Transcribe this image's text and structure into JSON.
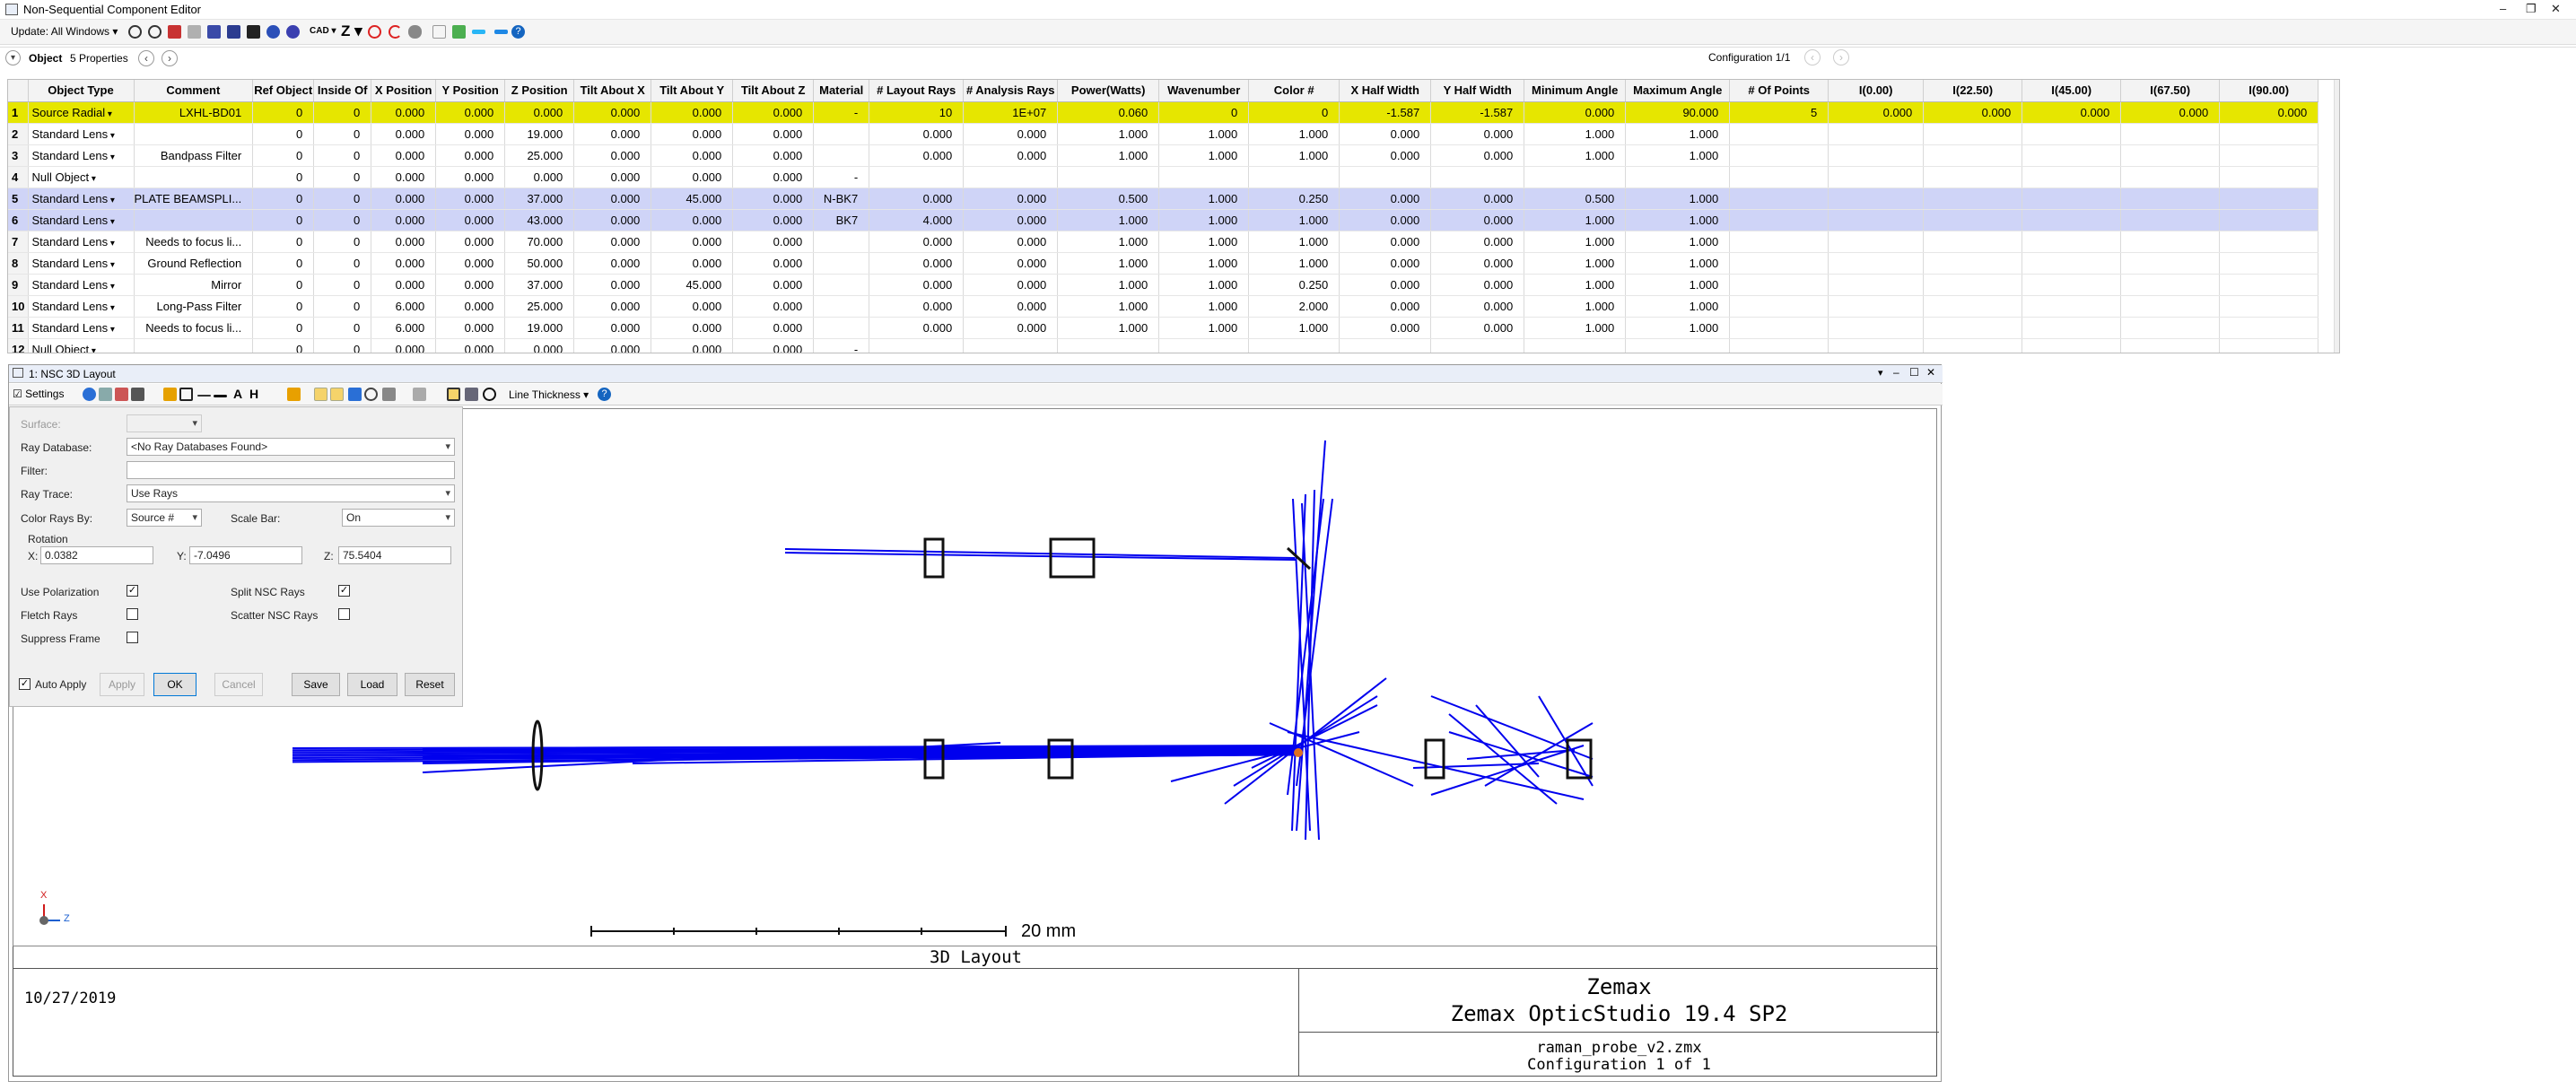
{
  "window": {
    "title": "Non-Sequential Component Editor"
  },
  "toolbar": {
    "update_label": "Update: All Windows",
    "cad_label": "CAD",
    "z_label": "Z"
  },
  "config": {
    "label": "Configuration 1/1"
  },
  "objectbar": {
    "title": "Object",
    "properties": "5 Properties"
  },
  "table": {
    "headers": [
      "Object Type",
      "Comment",
      "Ref Object",
      "Inside Of",
      "X Position",
      "Y Position",
      "Z Position",
      "Tilt About X",
      "Tilt About Y",
      "Tilt About Z",
      "Material",
      "# Layout Rays",
      "# Analysis Rays",
      "Power(Watts)",
      "Wavenumber",
      "Color #",
      "X Half Width",
      "Y Half Width",
      "Minimum Angle",
      "Maximum Angle",
      "# Of Points",
      "I(0.00)",
      "I(22.50)",
      "I(45.00)",
      "I(67.50)",
      "I(90.00)"
    ],
    "rows": [
      [
        "1",
        "Source Radial",
        "LXHL-BD01",
        "0",
        "0",
        "0.000",
        "0.000",
        "0.000",
        "0.000",
        "0.000",
        "0.000",
        "-",
        "10",
        "1E+07",
        "0.060",
        "0",
        "0",
        "-1.587",
        "-1.587",
        "0.000",
        "90.000",
        "5",
        "0.000",
        "0.000",
        "0.000",
        "0.000",
        "0.000"
      ],
      [
        "2",
        "Standard Lens",
        "",
        "0",
        "0",
        "0.000",
        "0.000",
        "19.000",
        "0.000",
        "0.000",
        "0.000",
        "",
        "0.000",
        "0.000",
        "1.000",
        "1.000",
        "1.000",
        "0.000",
        "0.000",
        "1.000",
        "1.000",
        "",
        "",
        "",
        "",
        "",
        ""
      ],
      [
        "3",
        "Standard Lens",
        "Bandpass Filter",
        "0",
        "0",
        "0.000",
        "0.000",
        "25.000",
        "0.000",
        "0.000",
        "0.000",
        "",
        "0.000",
        "0.000",
        "1.000",
        "1.000",
        "1.000",
        "0.000",
        "0.000",
        "1.000",
        "1.000",
        "",
        "",
        "",
        "",
        "",
        ""
      ],
      [
        "4",
        "Null Object",
        "",
        "0",
        "0",
        "0.000",
        "0.000",
        "0.000",
        "0.000",
        "0.000",
        "0.000",
        "-",
        "",
        "",
        "",
        "",
        "",
        "",
        "",
        "",
        "",
        "",
        "",
        "",
        "",
        "",
        ""
      ],
      [
        "5",
        "Standard Lens",
        "PLATE BEAMSPLI...",
        "0",
        "0",
        "0.000",
        "0.000",
        "37.000",
        "0.000",
        "45.000",
        "0.000",
        "N-BK7",
        "0.000",
        "0.000",
        "0.500",
        "1.000",
        "0.250",
        "0.000",
        "0.000",
        "0.500",
        "1.000",
        "",
        "",
        "",
        "",
        "",
        ""
      ],
      [
        "6",
        "Standard Lens",
        "",
        "0",
        "0",
        "0.000",
        "0.000",
        "43.000",
        "0.000",
        "0.000",
        "0.000",
        "BK7",
        "4.000",
        "0.000",
        "1.000",
        "1.000",
        "1.000",
        "0.000",
        "0.000",
        "1.000",
        "1.000",
        "",
        "",
        "",
        "",
        "",
        ""
      ],
      [
        "7",
        "Standard Lens",
        "Needs to focus li...",
        "0",
        "0",
        "0.000",
        "0.000",
        "70.000",
        "0.000",
        "0.000",
        "0.000",
        "",
        "0.000",
        "0.000",
        "1.000",
        "1.000",
        "1.000",
        "0.000",
        "0.000",
        "1.000",
        "1.000",
        "",
        "",
        "",
        "",
        "",
        ""
      ],
      [
        "8",
        "Standard Lens",
        "Ground Reflection",
        "0",
        "0",
        "0.000",
        "0.000",
        "50.000",
        "0.000",
        "0.000",
        "0.000",
        "",
        "0.000",
        "0.000",
        "1.000",
        "1.000",
        "1.000",
        "0.000",
        "0.000",
        "1.000",
        "1.000",
        "",
        "",
        "",
        "",
        "",
        ""
      ],
      [
        "9",
        "Standard Lens",
        "Mirror",
        "0",
        "0",
        "0.000",
        "0.000",
        "37.000",
        "0.000",
        "45.000",
        "0.000",
        "",
        "0.000",
        "0.000",
        "1.000",
        "1.000",
        "0.250",
        "0.000",
        "0.000",
        "1.000",
        "1.000",
        "",
        "",
        "",
        "",
        "",
        ""
      ],
      [
        "10",
        "Standard Lens",
        "Long-Pass Filter",
        "0",
        "0",
        "6.000",
        "0.000",
        "25.000",
        "0.000",
        "0.000",
        "0.000",
        "",
        "0.000",
        "0.000",
        "1.000",
        "1.000",
        "2.000",
        "0.000",
        "0.000",
        "1.000",
        "1.000",
        "",
        "",
        "",
        "",
        "",
        ""
      ],
      [
        "11",
        "Standard Lens",
        "Needs to focus li...",
        "0",
        "0",
        "6.000",
        "0.000",
        "19.000",
        "0.000",
        "0.000",
        "0.000",
        "",
        "0.000",
        "0.000",
        "1.000",
        "1.000",
        "1.000",
        "0.000",
        "0.000",
        "1.000",
        "1.000",
        "",
        "",
        "",
        "",
        "",
        ""
      ],
      [
        "12",
        "Null Object",
        "",
        "0",
        "0",
        "0.000",
        "0.000",
        "0.000",
        "0.000",
        "0.000",
        "0.000",
        "-",
        "",
        "",
        "",
        "",
        "",
        "",
        "",
        "",
        "",
        "",
        "",
        "",
        "",
        "",
        ""
      ]
    ]
  },
  "layout": {
    "title": "1: NSC 3D Layout",
    "settings_label": "Settings",
    "line_thickness": "Line Thickness",
    "surface_label": "Surface:",
    "ray_db_label": "Ray Database:",
    "ray_db_value": "<No Ray Databases Found>",
    "filter_label": "Filter:",
    "ray_trace_label": "Ray Trace:",
    "ray_trace_value": "Use Rays",
    "color_rays_label": "Color Rays By:",
    "color_rays_value": "Source #",
    "scale_bar_label": "Scale Bar:",
    "scale_bar_value": "On",
    "rotation_label": "Rotation",
    "rot_x": "0.0382",
    "rot_y": "-7.0496",
    "rot_z": "75.5404",
    "use_polarization": "Use Polarization",
    "split_nsc": "Split NSC Rays",
    "fletch_rays": "Fletch Rays",
    "scatter_nsc": "Scatter NSC Rays",
    "suppress_frame": "Suppress Frame",
    "auto_apply": "Auto Apply",
    "apply": "Apply",
    "ok": "OK",
    "cancel": "Cancel",
    "save": "Save",
    "load": "Load",
    "reset": "Reset",
    "scale_text": "20 mm",
    "plot_title": "3D Layout",
    "date": "10/27/2019",
    "brand": "Zemax",
    "product": "Zemax OpticStudio 19.4 SP2",
    "file": "raman_probe_v2.zmx",
    "config_text": "Configuration 1 of 1",
    "axis_x": "X",
    "axis_z": "Z"
  },
  "colors": {
    "highlight": "#e6e600",
    "selected": "#cfd4f7",
    "ray": "#0000ee"
  }
}
